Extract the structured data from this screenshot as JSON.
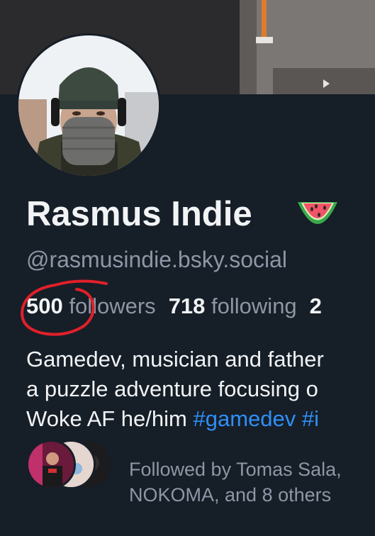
{
  "profile": {
    "display_name": "Rasmus Indie",
    "name_emoji": "watermelon-emoji",
    "handle": "@rasmusindie.bsky.social"
  },
  "stats": {
    "followers_count": "500",
    "followers_label": "followers",
    "following_count": "718",
    "following_label": "following",
    "posts_count_partial": "2"
  },
  "bio": {
    "line1": "Gamedev, musician and father",
    "line2": "a puzzle adventure focusing o",
    "line3_text": "Woke AF he/him ",
    "hashtag1": "#gamedev",
    "hashtag2_partial": "#i"
  },
  "followed_by": {
    "line1": "Followed by Tomas Sala,",
    "line2": "NOKOMA, and 8 others"
  },
  "colors": {
    "background": "#161e27",
    "text_primary": "#f1f3f5",
    "text_secondary": "#8d97a5",
    "link": "#2f8ff7",
    "annotation": "#e0202a"
  }
}
